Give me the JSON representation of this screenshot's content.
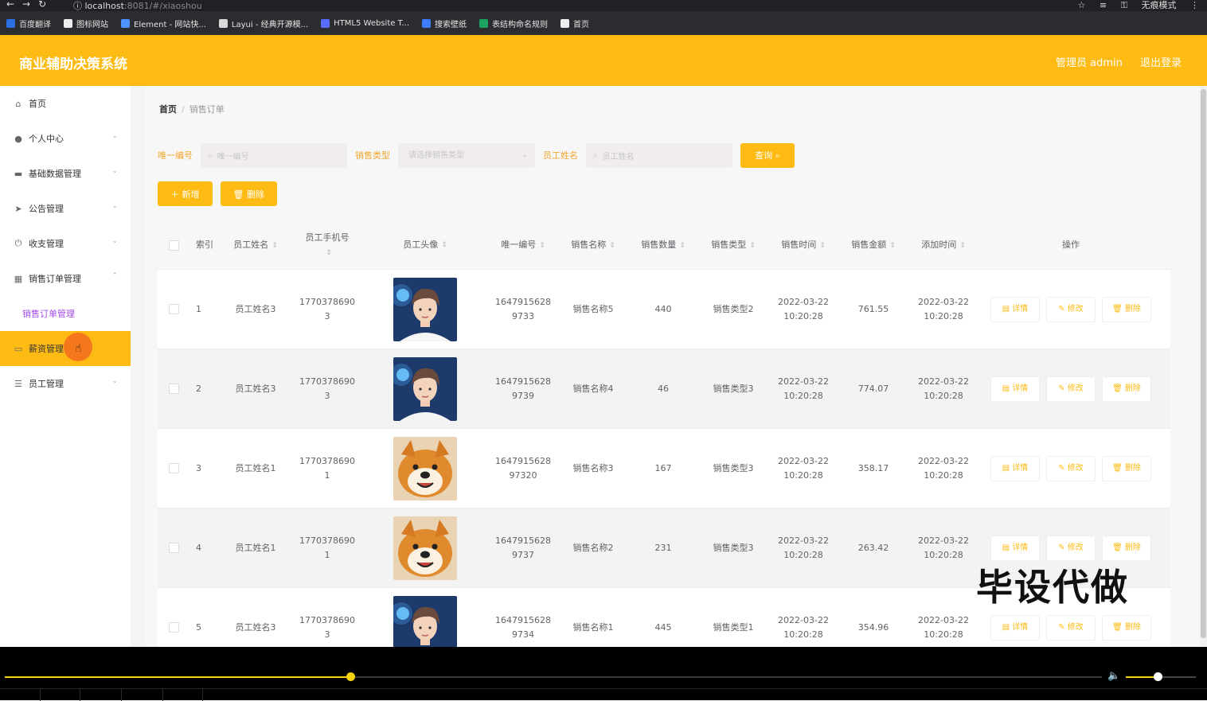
{
  "browser": {
    "url_host": "localhost",
    "url_path": ":8081/#/xiaoshou",
    "incognito_label": "无痕模式",
    "bookmarks": [
      {
        "label": "百度翻译",
        "color": "#2f6fe4"
      },
      {
        "label": "图标网站",
        "color": "#eeeeee"
      },
      {
        "label": "Element - 网站快...",
        "color": "#4d90fe"
      },
      {
        "label": "Layui - 经典开源模...",
        "color": "#d9d9d9"
      },
      {
        "label": "HTML5 Website T...",
        "color": "#5a6bff"
      },
      {
        "label": "搜索壁纸",
        "color": "#3d7bff"
      },
      {
        "label": "表结构命名规则",
        "color": "#1aa260"
      },
      {
        "label": "首页",
        "color": "#eeeeee"
      }
    ]
  },
  "header": {
    "title": "商业辅助决策系统",
    "user": "管理员 admin",
    "logout": "退出登录",
    "brand_color": "#fdbb13"
  },
  "sidebar": {
    "items": [
      {
        "label": "首页",
        "icon": "home-icon",
        "glyph": "⌂"
      },
      {
        "label": "个人中心",
        "icon": "user-icon",
        "glyph": "●",
        "chevron": "⌄"
      },
      {
        "label": "基础数据管理",
        "icon": "monitor-icon",
        "glyph": "▬",
        "chevron": "⌄"
      },
      {
        "label": "公告管理",
        "icon": "send-icon",
        "glyph": "➤",
        "chevron": "⌄"
      },
      {
        "label": "收支管理",
        "icon": "power-icon",
        "glyph": "⏻",
        "chevron": "⌄"
      },
      {
        "label": "销售订单管理",
        "icon": "grid-icon",
        "glyph": "▦",
        "chevron": "⌃"
      }
    ],
    "sub_item": "销售订单管理",
    "active_item": {
      "label": "薪资管理",
      "icon": "wallet-icon",
      "glyph": "▭"
    },
    "last_item": {
      "label": "员工管理",
      "icon": "menu-icon",
      "glyph": "☰",
      "chevron": "⌄"
    }
  },
  "breadcrumb": {
    "home": "首页",
    "sep": "/",
    "current": "销售订单"
  },
  "search": {
    "code_label": "唯一编号",
    "code_placeholder": "唯一编号",
    "type_label": "销售类型",
    "type_placeholder": "请选择销售类型",
    "name_label": "员工姓名",
    "name_placeholder": "员工姓名",
    "query_button": "查询 ⌕"
  },
  "actions": {
    "add": "＋ 新增",
    "delete": "🗑 删除"
  },
  "table": {
    "headers": {
      "index": "索引",
      "name": "员工姓名",
      "phone": "员工手机号",
      "avatar": "员工头像",
      "code": "唯一编号",
      "sale_name": "销售名称",
      "qty": "销售数量",
      "type": "销售类型",
      "time": "销售时间",
      "amount": "销售金额",
      "added": "添加时间",
      "ops": "操作"
    },
    "sort_glyph": "⇕",
    "op_labels": {
      "detail": "▤ 详情",
      "edit": "✎ 修改",
      "delete": "🗑 删除"
    },
    "rows": [
      {
        "index": "1",
        "name": "员工姓名3",
        "phone_a": "1770378690",
        "phone_b": "3",
        "avatar": "boy",
        "code_a": "1647915628",
        "code_b": "9733",
        "sale_name": "销售名称5",
        "qty": "440",
        "type": "销售类型2",
        "time_a": "2022-03-22",
        "time_b": "10:20:28",
        "amount": "761.55",
        "add_a": "2022-03-22",
        "add_b": "10:20:28"
      },
      {
        "index": "2",
        "name": "员工姓名3",
        "phone_a": "1770378690",
        "phone_b": "3",
        "avatar": "boy",
        "code_a": "1647915628",
        "code_b": "9739",
        "sale_name": "销售名称4",
        "qty": "46",
        "type": "销售类型3",
        "time_a": "2022-03-22",
        "time_b": "10:20:28",
        "amount": "774.07",
        "add_a": "2022-03-22",
        "add_b": "10:20:28"
      },
      {
        "index": "3",
        "name": "员工姓名1",
        "phone_a": "1770378690",
        "phone_b": "1",
        "avatar": "dog",
        "code_a": "1647915628",
        "code_b": "97320",
        "sale_name": "销售名称3",
        "qty": "167",
        "type": "销售类型3",
        "time_a": "2022-03-22",
        "time_b": "10:20:28",
        "amount": "358.17",
        "add_a": "2022-03-22",
        "add_b": "10:20:28"
      },
      {
        "index": "4",
        "name": "员工姓名1",
        "phone_a": "1770378690",
        "phone_b": "1",
        "avatar": "dog",
        "code_a": "1647915628",
        "code_b": "9737",
        "sale_name": "销售名称2",
        "qty": "231",
        "type": "销售类型3",
        "time_a": "2022-03-22",
        "time_b": "10:20:28",
        "amount": "263.42",
        "add_a": "2022-03-22",
        "add_b": "10:20:28"
      },
      {
        "index": "5",
        "name": "员工姓名3",
        "phone_a": "1770378690",
        "phone_b": "3",
        "avatar": "boy",
        "code_a": "1647915628",
        "code_b": "9734",
        "sale_name": "销售名称1",
        "qty": "445",
        "type": "销售类型1",
        "time_a": "2022-03-22",
        "time_b": "10:20:28",
        "amount": "354.96",
        "add_a": "2022-03-22",
        "add_b": "10:20:28"
      }
    ]
  },
  "watermark": "毕设代做",
  "player": {
    "progress": 0.315,
    "volume": 0.45,
    "accent": "#f5d10c"
  }
}
